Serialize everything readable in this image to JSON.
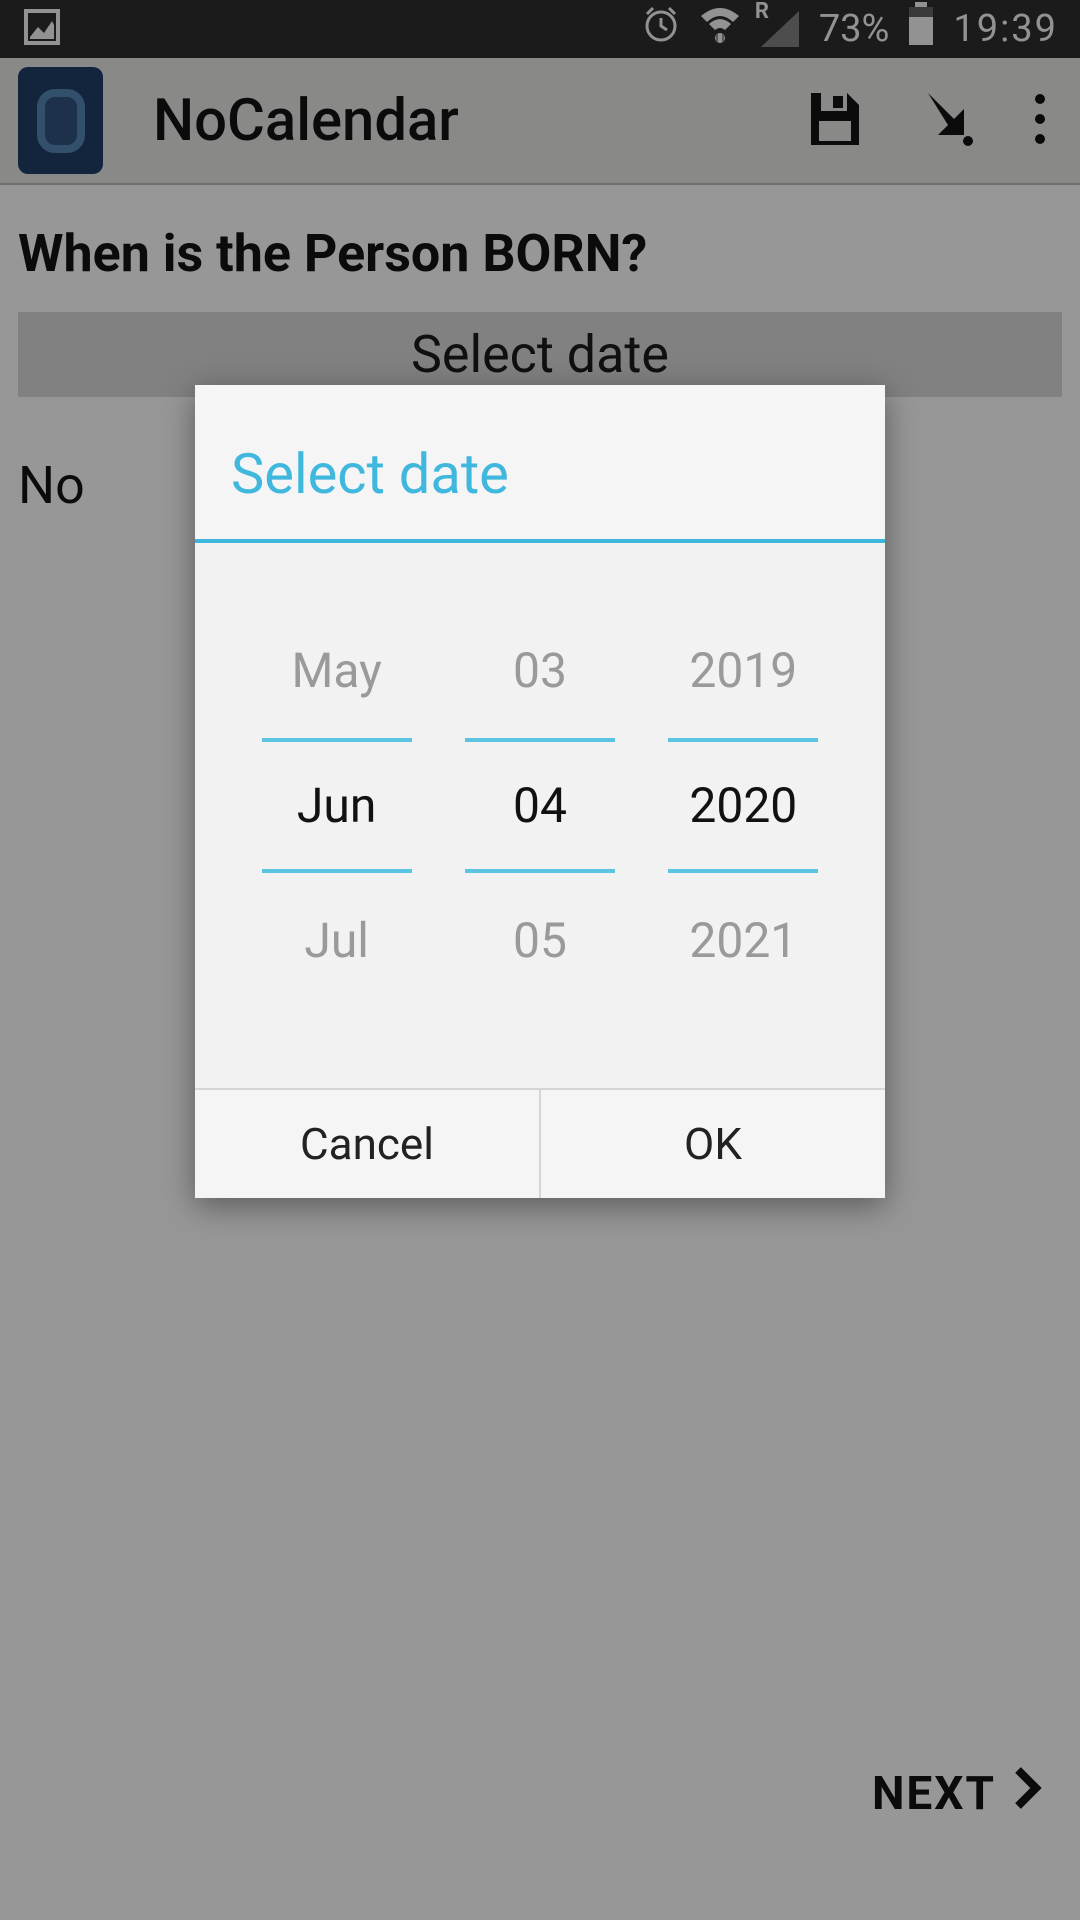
{
  "status": {
    "battery": "73%",
    "time": "19:39",
    "roaming": "R"
  },
  "appbar": {
    "title": "NoCalendar"
  },
  "content": {
    "question": "When is the Person BORN?",
    "select_btn": "Select date",
    "truncated": "No",
    "next": "NEXT"
  },
  "dialog": {
    "title": "Select date",
    "month_prev": "May",
    "month_current": "Jun",
    "month_next": "Jul",
    "day_prev": "03",
    "day_current": "04",
    "day_next": "05",
    "year_prev": "2019",
    "year_current": "2020",
    "year_next": "2021",
    "cancel": "Cancel",
    "ok": "OK"
  }
}
